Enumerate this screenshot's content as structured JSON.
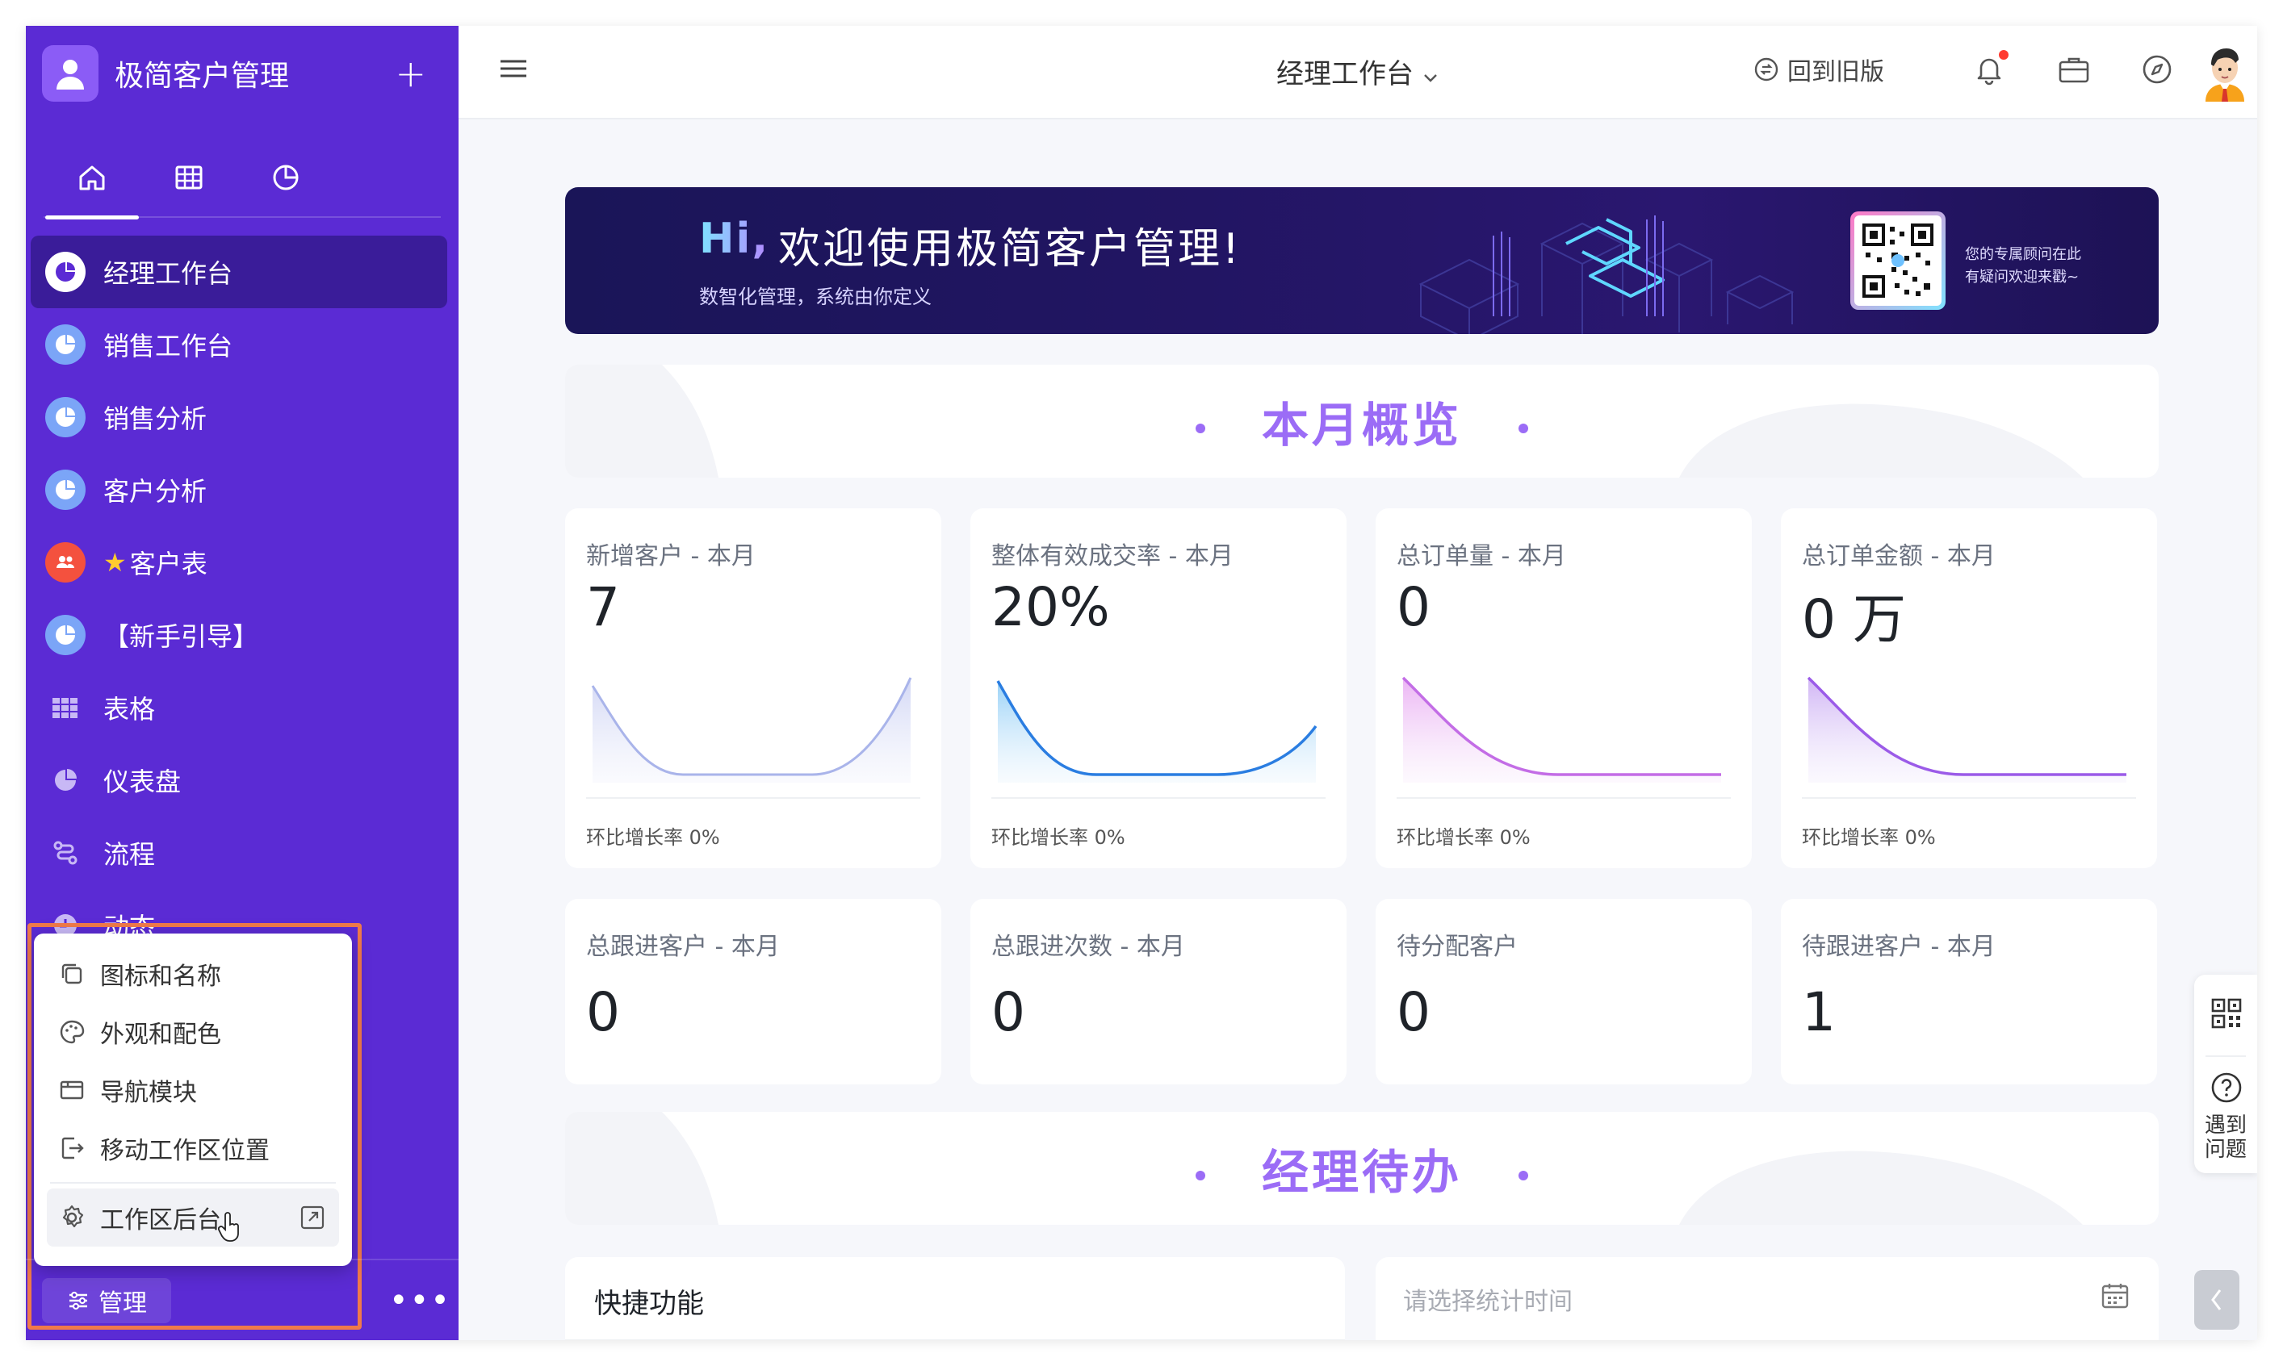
{
  "app": {
    "title": "极简客户管理"
  },
  "sidebar": {
    "tabs": [
      {
        "icon": "home-icon"
      },
      {
        "icon": "table-icon"
      },
      {
        "icon": "clock-pie-icon"
      }
    ],
    "items": [
      {
        "label": "经理工作台",
        "icon": "dashboard-icon",
        "active": true
      },
      {
        "label": "销售工作台",
        "icon": "dashboard-icon"
      },
      {
        "label": "销售分析",
        "icon": "dashboard-icon"
      },
      {
        "label": "客户分析",
        "icon": "dashboard-icon"
      },
      {
        "label": "客户表",
        "icon": "users-icon",
        "star": "★"
      },
      {
        "label": "【新手引导】",
        "icon": "dashboard-icon"
      },
      {
        "label": "表格",
        "icon": "grid-icon"
      },
      {
        "label": "仪表盘",
        "icon": "pie-icon"
      },
      {
        "label": "流程",
        "icon": "flow-icon"
      },
      {
        "label": "动态",
        "icon": "clock-icon"
      }
    ],
    "context_menu": {
      "items": [
        {
          "label": "图标和名称",
          "icon": "copy-icon"
        },
        {
          "label": "外观和配色",
          "icon": "palette-icon"
        },
        {
          "label": "导航模块",
          "icon": "layout-icon"
        },
        {
          "label": "移动工作区位置",
          "icon": "move-icon"
        }
      ],
      "backend": {
        "label": "工作区后台",
        "icon": "settings-icon"
      }
    },
    "footer": {
      "manage_label": "管理",
      "more_label": "•••"
    }
  },
  "topbar": {
    "title": "经理工作台",
    "old_version_label": "回到旧版"
  },
  "banner": {
    "hi": "Hi,",
    "title": "欢迎使用极简客户管理!",
    "subtitle": "数智化管理，系统由你定义",
    "qr_line1": "您的专属顾问在此",
    "qr_line2": "有疑问欢迎来戳~"
  },
  "sections": {
    "overview_title": "本月概览",
    "todo_title": "经理待办"
  },
  "kpis_row1": [
    {
      "label": "新增客户 - 本月",
      "value": "7",
      "footer": "环比增长率 0%",
      "color": "#a9b4ea"
    },
    {
      "label": "整体有效成交率 - 本月",
      "value": "20%",
      "footer": "环比增长率 0%",
      "color": "#2a7de1"
    },
    {
      "label": "总订单量 - 本月",
      "value": "0",
      "footer": "环比增长率 0%",
      "color": "#c36de6"
    },
    {
      "label": "总订单金额 - 本月",
      "value": "0 万",
      "footer": "环比增长率 0%",
      "color": "#9b5be8"
    }
  ],
  "kpis_row2": [
    {
      "label": "总跟进客户 - 本月",
      "value": "0"
    },
    {
      "label": "总跟进次数 - 本月",
      "value": "0"
    },
    {
      "label": "待分配客户",
      "value": "0"
    },
    {
      "label": "待跟进客户 - 本月",
      "value": "1"
    }
  ],
  "quick": {
    "title": "快捷功能"
  },
  "date_picker": {
    "placeholder": "请选择统计时间"
  },
  "float_panel": {
    "help_label": "遇到问题"
  },
  "colors": {
    "sidebar": "#5b2bd4",
    "accent": "#9b6cf6",
    "highlight": "#f07a4a"
  }
}
